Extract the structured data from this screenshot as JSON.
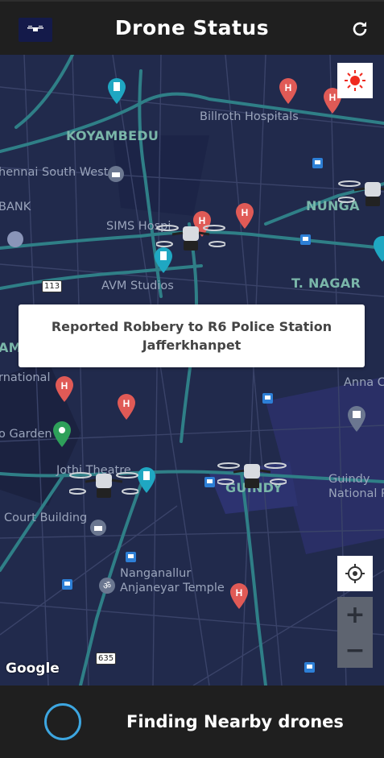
{
  "header": {
    "title": "Drone Status"
  },
  "map": {
    "labels": {
      "koyambedu": "KOYAMBEDU",
      "billroth": "Billroth Hospitals",
      "chennai_south_west": "hennai South West",
      "bank": "BANK",
      "nunga": "NUNGA",
      "sims": "SIMS Hospi",
      "avm": "AVM Studios",
      "t_nagar": "T. NAGAR",
      "am": "AM",
      "national": "rnational",
      "anna": "Anna C",
      "garden": "o Garden",
      "jothi": "Jothi Theatre",
      "guindy": "GUINDY",
      "guindy_park": "Guindy\nNational Park",
      "court": "Court Building",
      "nanganallur": "Nanganallur\nAnjaneyar Temple",
      "shield_113": "113",
      "shield_635": "635"
    },
    "banner": "Reported Robbery to R6 Police Station Jafferkhanpet",
    "zoom_in": "+",
    "zoom_out": "−",
    "attribution": "Google",
    "marker_icons": [
      "hospital-pin",
      "cinema-pin",
      "place-of-worship-pin",
      "park-pin",
      "library-pin",
      "transit-icon"
    ]
  },
  "footer": {
    "status": "Finding Nearby drones"
  },
  "colors": {
    "map_bg": "#212a4c",
    "road_major": "#2f7f87",
    "hospital_pin": "#e05a56",
    "cinema_pin": "#1fa7c2",
    "spinner": "#3da6e0"
  }
}
